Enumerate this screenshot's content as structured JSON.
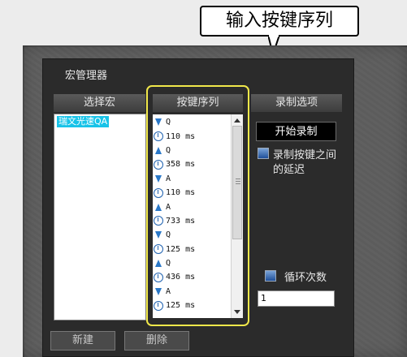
{
  "annotation": {
    "text": "输入按键序列"
  },
  "window": {
    "title": "宏管理器"
  },
  "columns": {
    "select_macro": "选择宏",
    "key_sequence": "按键序列",
    "record_options": "录制选项"
  },
  "macro_list": {
    "items": [
      "瑞文光速QA"
    ]
  },
  "sequence": [
    {
      "icon": "arrow-down-icon",
      "text": "Q"
    },
    {
      "icon": "clock-icon",
      "text": "110 ms"
    },
    {
      "icon": "arrow-up-icon",
      "text": "Q"
    },
    {
      "icon": "clock-icon",
      "text": "358 ms"
    },
    {
      "icon": "arrow-down-icon",
      "text": "A"
    },
    {
      "icon": "clock-icon",
      "text": "110 ms"
    },
    {
      "icon": "arrow-up-icon",
      "text": "A"
    },
    {
      "icon": "clock-icon",
      "text": "733 ms"
    },
    {
      "icon": "arrow-down-icon",
      "text": "Q"
    },
    {
      "icon": "clock-icon",
      "text": "125 ms"
    },
    {
      "icon": "arrow-up-icon",
      "text": "Q"
    },
    {
      "icon": "clock-icon",
      "text": "436 ms"
    },
    {
      "icon": "arrow-down-icon",
      "text": "A"
    },
    {
      "icon": "clock-icon",
      "text": "125 ms"
    }
  ],
  "record": {
    "start_label": "开始录制",
    "record_delay_label_1": "录制按键之间",
    "record_delay_label_2": "的延迟",
    "loop_label": "循环次数",
    "loop_value": "1"
  },
  "buttons": {
    "new_label": "新建",
    "delete_label": "删除"
  },
  "colors": {
    "highlight": "#f1e84a",
    "selection": "#18c3e8",
    "icon_blue": "#2a78c8"
  }
}
